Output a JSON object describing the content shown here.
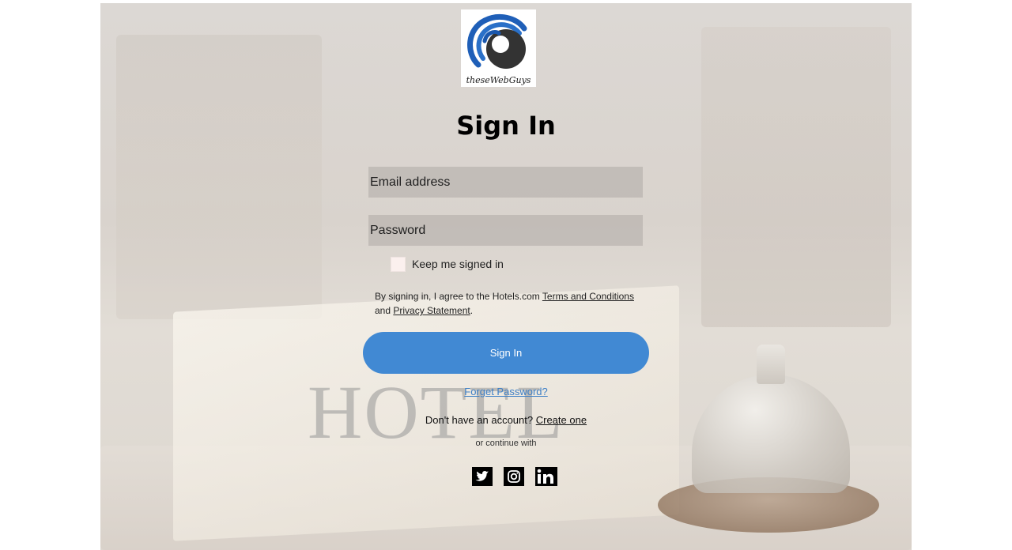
{
  "logo": {
    "caption": "theseWebGuys",
    "icon": "eye-swirl-logo"
  },
  "title": "Sign In",
  "form": {
    "email_placeholder": "Email address",
    "password_placeholder": "Password",
    "remember_label": "Keep me signed in",
    "remember_checked": false
  },
  "terms": {
    "prefix": "By signing in, I agree to the Hotels.com ",
    "terms_link": "Terms and Conditions",
    "middle": " and ",
    "privacy_link": "Privacy Statement",
    "suffix": "."
  },
  "signin_button": "Sign In",
  "forgot_password": "Forget Password?",
  "signup": {
    "prefix": "Don't have an account? ",
    "link": "Create one"
  },
  "continue_with": "or continue with",
  "socials": [
    "twitter-icon",
    "instagram-icon",
    "linkedin-icon"
  ],
  "background_text": "HOTEL",
  "colors": {
    "accent": "#4189d3",
    "link": "#3d7fc6",
    "field_bg": "#afaaa6"
  }
}
